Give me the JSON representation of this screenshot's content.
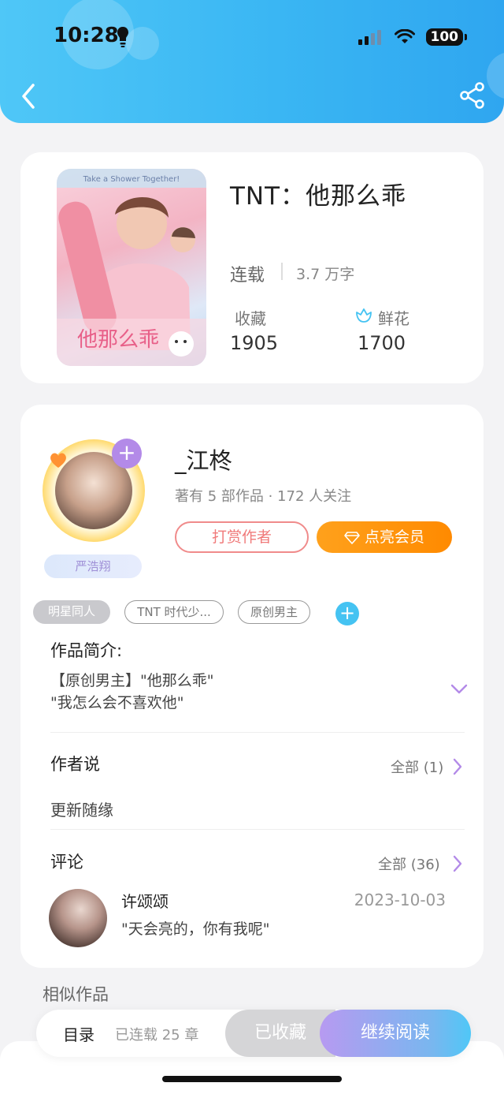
{
  "status_bar": {
    "time": "10:28",
    "battery": "100"
  },
  "book": {
    "title": "TNT：他那么乖",
    "status": "连载",
    "word_count": "3.7 万字",
    "favorites_label": "收藏",
    "favorites_value": "1905",
    "flowers_label": "鲜花",
    "flowers_value": "1700",
    "cover_title": "他那么乖",
    "cover_banner": "Take a Shower Together!"
  },
  "author": {
    "name": "_江柊",
    "meta": "著有 5 部作品 · 172 人关注",
    "fan_tag": "严浩翔",
    "follow_symbol": "+",
    "tip_label": "打赏作者",
    "vip_label": "点亮会员"
  },
  "tags": [
    "明星同人",
    "TNT 时代少...",
    "原创男主"
  ],
  "add_tag_symbol": "+",
  "intro": {
    "heading": "作品简介:",
    "text": "【原创男主】\"他那么乖\"\n\"我怎么会不喜欢他\""
  },
  "author_says": {
    "heading": "作者说",
    "all_label": "全部 (1)",
    "note": "更新随缘"
  },
  "comments": {
    "heading": "评论",
    "all_label": "全部 (36)",
    "items": [
      {
        "user": "许颂颂",
        "date": "2023-10-03",
        "text": "\"天会亮的，你有我呢\""
      }
    ]
  },
  "similar": {
    "heading": "相似作品"
  },
  "bottom": {
    "toc_label": "目录",
    "chapters": "已连载 25 章",
    "collected_label": "已收藏",
    "read_label": "继续阅读"
  },
  "colors": {
    "header_blue": "#3ab6f3",
    "accent_purple": "#b38ae8",
    "vip_orange": "#ff8a00",
    "tip_red": "#f07a7a",
    "tag_blue": "#45c3f2"
  }
}
